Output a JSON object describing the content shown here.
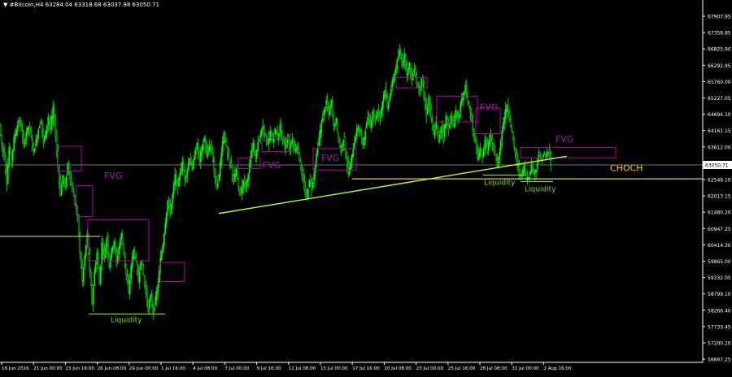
{
  "header": {
    "symbol": "#Bitcoin,H4",
    "ohlc": "63284.04 63318.68 63037.98 63050.71"
  },
  "colors": {
    "background": "#000000",
    "bull": "#00ff00",
    "bear": "#00ff00",
    "fvg_box": "#b000b0",
    "fvg_text": "#a020a0",
    "liquidity": "#7fd820",
    "level_line": "#e8c84a",
    "trendline": "#b8ff20",
    "choch_text": "#ffd000",
    "current_price_line": "#8899aa",
    "axis_text": "#ffffff",
    "axis_border": "#ffffff"
  },
  "price_axis": {
    "min": 56667.65,
    "max": 68170.0,
    "labels": [
      "67907.95",
      "67358.85",
      "66825.90",
      "66292.95",
      "65760.00",
      "65227.05",
      "64694.10",
      "64161.15",
      "63612.00",
      "63079.05",
      "62546.10",
      "62013.15",
      "61480.20",
      "60947.25",
      "60414.30",
      "59865.00",
      "59332.05",
      "58799.10",
      "58266.40",
      "57733.45",
      "57200.20",
      "56667.25"
    ],
    "current_price": "63050.71"
  },
  "time_axis": {
    "labels": [
      "18 Jun 2026",
      "21 Jun 00:00",
      "23 Jun 16:00",
      "26 Jun 08:00",
      "29 Jun 00:00",
      "1 Jul 16:00",
      "4 Jul 08:00",
      "7 Jul 00:00",
      "9 Jul 16:00",
      "12 Jul 08:00",
      "15 Jul 00:00",
      "17 Jul 16:00",
      "20 Jul 08:00",
      "23 Jul 00:00",
      "25 Jul 16:00",
      "28 Jul 08:00",
      "31 Jul 00:00",
      "2 Aug 16:00"
    ]
  },
  "annotations": {
    "fvg_labels": [
      "FVG",
      "FVG",
      "FVG",
      "FVG",
      "FVG"
    ],
    "liquidity_labels": [
      "Liquidity",
      "Liquidity",
      "Liquidity"
    ],
    "choch_label": "CHOCH"
  },
  "chart_data": {
    "type": "candlestick",
    "title": "#Bitcoin,H4",
    "ylim": [
      56667.65,
      68170.0
    ],
    "price_path": [
      [
        0,
        64350
      ],
      [
        3,
        63700
      ],
      [
        6,
        63300
      ],
      [
        9,
        62500
      ],
      [
        12,
        63600
      ],
      [
        15,
        63200
      ],
      [
        18,
        63900
      ],
      [
        21,
        64200
      ],
      [
        24,
        64500
      ],
      [
        27,
        64200
      ],
      [
        30,
        63700
      ],
      [
        33,
        64100
      ],
      [
        36,
        64300
      ],
      [
        39,
        63900
      ],
      [
        42,
        63500
      ],
      [
        45,
        63800
      ],
      [
        48,
        64200
      ],
      [
        51,
        64500
      ],
      [
        54,
        63800
      ],
      [
        57,
        64100
      ],
      [
        60,
        64600
      ],
      [
        63,
        64200
      ],
      [
        66,
        64900
      ],
      [
        69,
        64000
      ],
      [
        72,
        63000
      ],
      [
        75,
        62100
      ],
      [
        78,
        62700
      ],
      [
        81,
        62300
      ],
      [
        84,
        63100
      ],
      [
        87,
        62600
      ],
      [
        90,
        62200
      ],
      [
        93,
        61800
      ],
      [
        96,
        61400
      ],
      [
        99,
        60200
      ],
      [
        102,
        59300
      ],
      [
        105,
        60100
      ],
      [
        108,
        60800
      ],
      [
        111,
        59600
      ],
      [
        114,
        58600
      ],
      [
        117,
        59600
      ],
      [
        120,
        60200
      ],
      [
        123,
        59200
      ],
      [
        126,
        60500
      ],
      [
        129,
        60100
      ],
      [
        132,
        60700
      ],
      [
        135,
        59800
      ],
      [
        138,
        60300
      ],
      [
        141,
        60600
      ],
      [
        144,
        59900
      ],
      [
        147,
        60400
      ],
      [
        150,
        60800
      ],
      [
        153,
        60200
      ],
      [
        156,
        59500
      ],
      [
        159,
        58900
      ],
      [
        162,
        59800
      ],
      [
        165,
        60300
      ],
      [
        168,
        59900
      ],
      [
        171,
        59300
      ],
      [
        174,
        60000
      ],
      [
        177,
        59500
      ],
      [
        180,
        58900
      ],
      [
        183,
        58400
      ],
      [
        186,
        58800
      ],
      [
        189,
        58300
      ],
      [
        192,
        58700
      ],
      [
        195,
        59200
      ],
      [
        198,
        60000
      ],
      [
        201,
        60500
      ],
      [
        204,
        61200
      ],
      [
        207,
        61900
      ],
      [
        210,
        61500
      ],
      [
        213,
        62100
      ],
      [
        216,
        62700
      ],
      [
        219,
        62300
      ],
      [
        222,
        62800
      ],
      [
        225,
        63100
      ],
      [
        228,
        62600
      ],
      [
        231,
        62900
      ],
      [
        234,
        63300
      ],
      [
        237,
        62900
      ],
      [
        240,
        63400
      ],
      [
        243,
        63700
      ],
      [
        246,
        63200
      ],
      [
        249,
        63600
      ],
      [
        252,
        63900
      ],
      [
        255,
        63300
      ],
      [
        258,
        63700
      ],
      [
        261,
        63500
      ],
      [
        264,
        62900
      ],
      [
        267,
        62300
      ],
      [
        270,
        62700
      ],
      [
        273,
        63500
      ],
      [
        276,
        64100
      ],
      [
        279,
        63600
      ],
      [
        282,
        63200
      ],
      [
        285,
        63000
      ],
      [
        288,
        62500
      ],
      [
        291,
        62900
      ],
      [
        294,
        62300
      ],
      [
        297,
        62100
      ],
      [
        300,
        62600
      ],
      [
        303,
        62300
      ],
      [
        306,
        62800
      ],
      [
        309,
        63300
      ],
      [
        312,
        63700
      ],
      [
        315,
        63300
      ],
      [
        318,
        63800
      ],
      [
        321,
        64000
      ],
      [
        324,
        64300
      ],
      [
        327,
        63900
      ],
      [
        330,
        63700
      ],
      [
        333,
        64100
      ],
      [
        336,
        63800
      ],
      [
        339,
        64200
      ],
      [
        342,
        63900
      ],
      [
        345,
        64300
      ],
      [
        348,
        63900
      ],
      [
        351,
        63600
      ],
      [
        354,
        63900
      ],
      [
        357,
        63600
      ],
      [
        360,
        63900
      ],
      [
        363,
        63500
      ],
      [
        366,
        63700
      ],
      [
        369,
        63200
      ],
      [
        372,
        62700
      ],
      [
        375,
        62300
      ],
      [
        378,
        62000
      ],
      [
        381,
        62600
      ],
      [
        384,
        62300
      ],
      [
        387,
        62800
      ],
      [
        390,
        63400
      ],
      [
        393,
        63900
      ],
      [
        396,
        64400
      ],
      [
        399,
        64800
      ],
      [
        402,
        65100
      ],
      [
        405,
        64700
      ],
      [
        408,
        65100
      ],
      [
        411,
        64300
      ],
      [
        414,
        64500
      ],
      [
        417,
        63800
      ],
      [
        420,
        63500
      ],
      [
        423,
        63900
      ],
      [
        426,
        63300
      ],
      [
        429,
        62800
      ],
      [
        432,
        63100
      ],
      [
        435,
        63600
      ],
      [
        438,
        64000
      ],
      [
        441,
        64300
      ],
      [
        444,
        64000
      ],
      [
        447,
        63700
      ],
      [
        450,
        64200
      ],
      [
        453,
        64600
      ],
      [
        456,
        64300
      ],
      [
        459,
        64800
      ],
      [
        462,
        64500
      ],
      [
        465,
        64800
      ],
      [
        468,
        64600
      ],
      [
        471,
        65100
      ],
      [
        474,
        65500
      ],
      [
        477,
        64900
      ],
      [
        480,
        65300
      ],
      [
        483,
        65700
      ],
      [
        486,
        66000
      ],
      [
        489,
        66400
      ],
      [
        492,
        66700
      ],
      [
        495,
        66300
      ],
      [
        498,
        66600
      ],
      [
        501,
        66000
      ],
      [
        504,
        66300
      ],
      [
        507,
        65800
      ],
      [
        510,
        66200
      ],
      [
        513,
        65700
      ],
      [
        516,
        65400
      ],
      [
        519,
        65900
      ],
      [
        522,
        65200
      ],
      [
        525,
        64700
      ],
      [
        528,
        65200
      ],
      [
        531,
        64500
      ],
      [
        534,
        64000
      ],
      [
        537,
        64400
      ],
      [
        540,
        63800
      ],
      [
        543,
        64300
      ],
      [
        546,
        64000
      ],
      [
        549,
        64600
      ],
      [
        552,
        64200
      ],
      [
        555,
        64600
      ],
      [
        558,
        64300
      ],
      [
        561,
        64800
      ],
      [
        564,
        64500
      ],
      [
        567,
        65000
      ],
      [
        570,
        65300
      ],
      [
        573,
        65600
      ],
      [
        576,
        65100
      ],
      [
        579,
        64700
      ],
      [
        582,
        64200
      ],
      [
        585,
        63800
      ],
      [
        588,
        63200
      ],
      [
        591,
        63600
      ],
      [
        594,
        63300
      ],
      [
        597,
        63900
      ],
      [
        600,
        63500
      ],
      [
        603,
        64000
      ],
      [
        606,
        63700
      ],
      [
        609,
        63400
      ],
      [
        612,
        63000
      ],
      [
        615,
        63500
      ],
      [
        618,
        64200
      ],
      [
        621,
        64600
      ],
      [
        624,
        65000
      ],
      [
        627,
        64600
      ],
      [
        630,
        64100
      ],
      [
        633,
        63600
      ],
      [
        636,
        63200
      ],
      [
        639,
        62800
      ],
      [
        642,
        62700
      ],
      [
        645,
        63000
      ],
      [
        648,
        62600
      ],
      [
        651,
        62700
      ],
      [
        654,
        63000
      ],
      [
        657,
        62800
      ],
      [
        660,
        62900
      ],
      [
        663,
        63400
      ],
      [
        666,
        63200
      ],
      [
        669,
        63400
      ],
      [
        672,
        63300
      ],
      [
        675,
        63500
      ],
      [
        678,
        63100
      ]
    ],
    "fvg_zones": [
      {
        "t0": 72,
        "t1": 100,
        "p_top": 63650,
        "p_bot": 62850
      },
      {
        "t0": 94,
        "t1": 114,
        "p_top": 62380,
        "p_bot": 61380
      },
      {
        "t0": 108,
        "t1": 183,
        "p_top": 61280,
        "p_bot": 59950
      },
      {
        "t0": 197,
        "t1": 227,
        "p_top": 59900,
        "p_bot": 59280
      },
      {
        "t0": 293,
        "t1": 320,
        "p_top": 63270,
        "p_bot": 62930
      },
      {
        "t0": 322,
        "t1": 355,
        "p_top": 63930,
        "p_bot": 63480
      },
      {
        "t0": 385,
        "t1": 438,
        "p_top": 63580,
        "p_bot": 62880
      },
      {
        "t0": 487,
        "t1": 525,
        "p_top": 65880,
        "p_bot": 65540
      },
      {
        "t0": 537,
        "t1": 587,
        "p_top": 65270,
        "p_bot": 64440
      },
      {
        "t0": 585,
        "t1": 615,
        "p_top": 64890,
        "p_bot": 64060
      },
      {
        "t0": 640,
        "t1": 757,
        "p_top": 63610,
        "p_bot": 63280
      }
    ],
    "fvg_label_positions": [
      {
        "t": 128,
        "p": 62600
      },
      {
        "t": 323,
        "p": 62950
      },
      {
        "t": 395,
        "p": 63180
      },
      {
        "t": 590,
        "p": 64820
      },
      {
        "t": 683,
        "p": 63790
      }
    ],
    "liquidity_lines": [
      {
        "t0": 109,
        "t1": 203,
        "p": 58230
      },
      {
        "t0": 594,
        "t1": 646,
        "p": 62720
      },
      {
        "t0": 640,
        "t1": 680,
        "p": 62510
      }
    ],
    "liquidity_label_positions": [
      {
        "t": 136,
        "p": 57970
      },
      {
        "t": 595,
        "p": 62400
      },
      {
        "t": 645,
        "p": 62200
      }
    ],
    "level_lines": [
      {
        "t0": 0,
        "t1": 123,
        "p": 60740
      },
      {
        "t0": 433,
        "t1": 864,
        "p": 62600
      }
    ],
    "trendline": {
      "t0": 269,
      "p0": 61480,
      "t1": 697,
      "p1": 63330
    },
    "choch_position": {
      "t": 750,
      "p": 62850
    }
  }
}
